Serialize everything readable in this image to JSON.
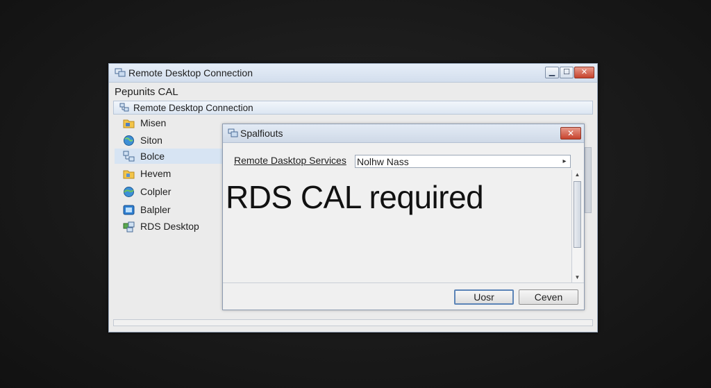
{
  "main_window": {
    "title": "Remote Desktop Connection",
    "subheading": "Pepunits CAL",
    "address": "Remote Desktop Connection",
    "sidebar": {
      "items": [
        {
          "label": "Misen",
          "icon": "folder-icon"
        },
        {
          "label": "Siton",
          "icon": "globe-icon"
        },
        {
          "label": "Bolce",
          "icon": "network-icon",
          "selected": true
        },
        {
          "label": "Hevem",
          "icon": "folder-icon"
        },
        {
          "label": "Colpler",
          "icon": "globe-icon"
        },
        {
          "label": "Balpler",
          "icon": "monitor-icon"
        },
        {
          "label": "RDS Desktop",
          "icon": "network-icon"
        }
      ]
    }
  },
  "dialog": {
    "title": "Spalfiouts",
    "field_label": "Remote Dasktop Services",
    "combo_value": "Nolhw Nass",
    "message": "RDS CAL required",
    "ok_label": "Uosr",
    "cancel_label": "Ceven"
  },
  "colors": {
    "accent": "#5b84b7",
    "close_button": "#c7432d",
    "selection": "#d7e4f3"
  }
}
